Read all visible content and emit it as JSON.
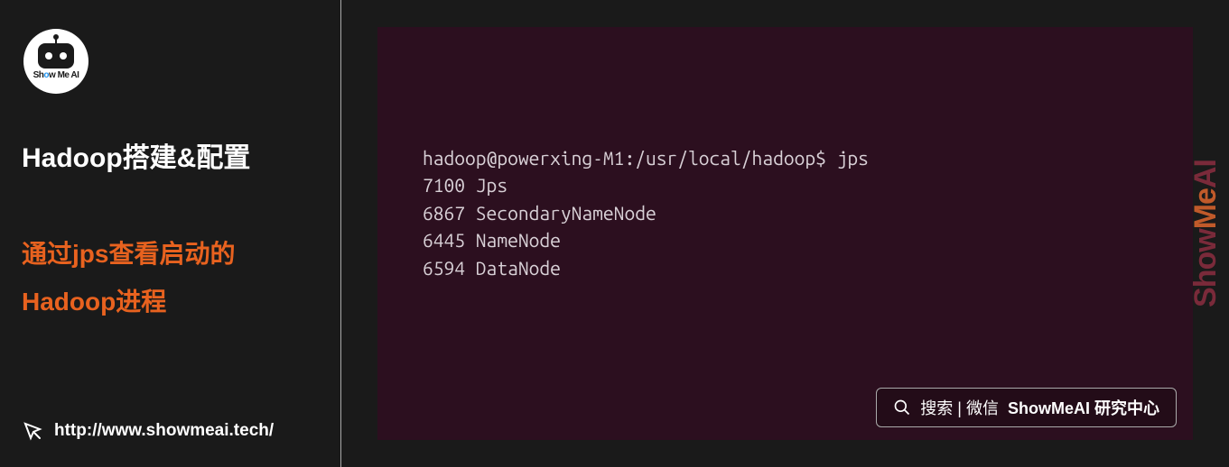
{
  "sidebar": {
    "logo_text": "Show Me AI",
    "title": "Hadoop搭建&配置",
    "subtitle_line1": "通过jps查看启动的",
    "subtitle_line2": "Hadoop进程",
    "website_url": "http://www.showmeai.tech/"
  },
  "terminal": {
    "prompt": "hadoop@powerxing-M1:/usr/local/hadoop$",
    "command": "jps",
    "output": [
      "7100 Jps",
      "6867 SecondaryNameNode",
      "6445 NameNode",
      "6594 DataNode"
    ]
  },
  "watermark": "ShowMeAI",
  "search": {
    "prefix": "搜索 | 微信",
    "name": "ShowMeAI 研究中心"
  }
}
